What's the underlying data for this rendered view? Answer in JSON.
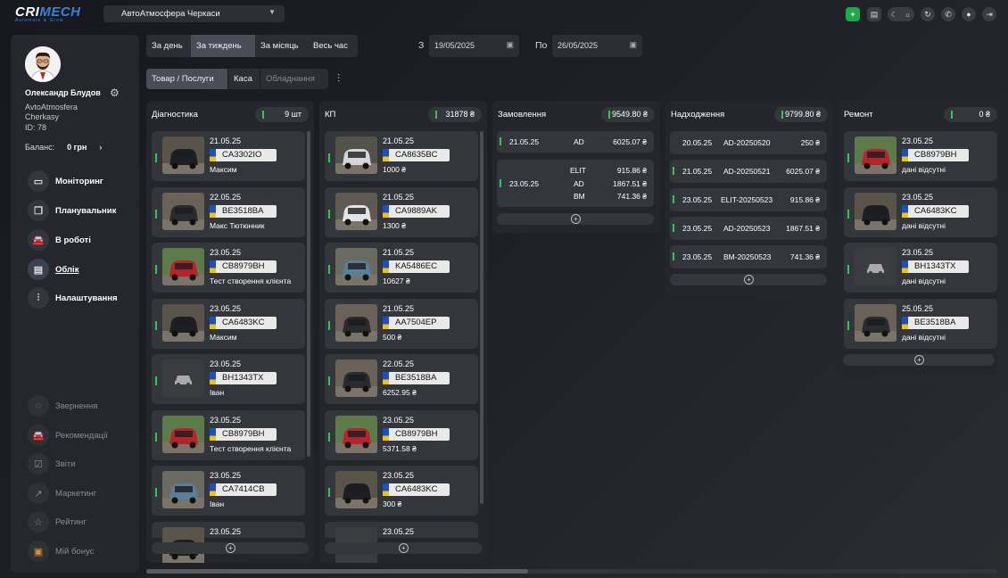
{
  "brand": {
    "name_a": "CRI",
    "name_b": "MECH",
    "tagline": "Automate & Grow",
    "accent": "#3b82d9"
  },
  "station": {
    "selected": "АвтоАтмосфера Черкаси"
  },
  "topbar": {
    "icons": [
      "add-icon",
      "calendar-box-icon",
      "moon-icon",
      "sun-icon",
      "refresh-icon",
      "phone-icon",
      "chat-icon",
      "logout-icon"
    ]
  },
  "user": {
    "name": "Олександр Блудов",
    "company": "AvtoAtmosfera",
    "city": "Cherkasy",
    "id": "ID: 78",
    "balance_label": "Баланс:",
    "balance_value": "0 грн",
    "balance_arrow": "›"
  },
  "nav": [
    {
      "label": "Моніторинг",
      "icon": "camera-icon"
    },
    {
      "label": "Планувальник",
      "icon": "pages-icon"
    },
    {
      "label": "В роботі",
      "icon": "car-icon"
    },
    {
      "label": "Облік",
      "icon": "document-icon",
      "active": true
    },
    {
      "label": "Налаштування",
      "icon": "sliders-icon"
    }
  ],
  "nav_bottom": [
    {
      "label": "Звернення",
      "icon": "message-icon"
    },
    {
      "label": "Рекомендації",
      "icon": "car-icon"
    },
    {
      "label": "Звіти",
      "icon": "checklist-icon"
    },
    {
      "label": "Маркетинг",
      "icon": "chart-icon"
    },
    {
      "label": "Рейтинг",
      "icon": "star-icon"
    },
    {
      "label": "Мій бонус",
      "icon": "gift-icon"
    }
  ],
  "period": {
    "buttons": [
      "За день",
      "За тиждень",
      "За місяць",
      "Весь час"
    ],
    "selected": "За тиждень",
    "from_label": "З",
    "from": "19/05/2025",
    "to_label": "По",
    "to": "26/05/2025"
  },
  "tabs": {
    "items": [
      "Товар / Послуги",
      "Каса",
      "Обладнання"
    ],
    "selected": "Товар / Послуги"
  },
  "columns": {
    "diag": {
      "title": "Діагностика",
      "badge": "9 шт",
      "cards": [
        {
          "date": "21.05.25",
          "plate": "CA3302IO",
          "sub": "Максим",
          "car": "dark-suv"
        },
        {
          "date": "22.05.25",
          "plate": "BE3518BA",
          "sub": "Макс Тютюнник",
          "car": "dark-wagon"
        },
        {
          "date": "23.05.25",
          "plate": "CB8979BH",
          "sub": "Тест створення клієнта",
          "car": "red"
        },
        {
          "date": "23.05.25",
          "plate": "CA6483KC",
          "sub": "Максим",
          "car": "dark-suv"
        },
        {
          "date": "23.05.25",
          "plate": "BH1343TX",
          "sub": "Іван",
          "car": "none"
        },
        {
          "date": "23.05.25",
          "plate": "CB8979BH",
          "sub": "Тест створення клієнта",
          "car": "red"
        },
        {
          "date": "23.05.25",
          "plate": "CA7414CB",
          "sub": "Іван",
          "car": "blue"
        },
        {
          "date": "23.05.25",
          "plate": "",
          "sub": "",
          "car": "dark-suv"
        }
      ]
    },
    "kp": {
      "title": "КП",
      "badge": "31878 ₴",
      "cards": [
        {
          "date": "21.05.25",
          "plate": "CA8635BC",
          "sub": "1000 ₴",
          "car": "van"
        },
        {
          "date": "21.05.25",
          "plate": "CA9889AK",
          "sub": "1300 ₴",
          "car": "white"
        },
        {
          "date": "21.05.25",
          "plate": "KA5486EC",
          "sub": "10627 ₴",
          "car": "blue"
        },
        {
          "date": "21.05.25",
          "plate": "AA7504EP",
          "sub": "500 ₴",
          "car": "dark-wagon"
        },
        {
          "date": "22.05.25",
          "plate": "BE3518BA",
          "sub": "6252.95 ₴",
          "car": "dark-wagon"
        },
        {
          "date": "23.05.25",
          "plate": "CB8979BH",
          "sub": "5371.58 ₴",
          "car": "red"
        },
        {
          "date": "23.05.25",
          "plate": "CA6483KC",
          "sub": "300 ₴",
          "car": "dark-suv"
        },
        {
          "date": "23.05.25",
          "plate": "",
          "sub": "",
          "car": "none"
        }
      ]
    },
    "orders": {
      "title": "Замовлення",
      "badge": "9549.80 ₴",
      "rows": [
        {
          "date": "21.05.25",
          "lines": [
            {
              "code": "AD",
              "amount": "6025.07 ₴"
            }
          ]
        },
        {
          "date": "23.05.25",
          "lines": [
            {
              "code": "ELIT",
              "amount": "915.86 ₴"
            },
            {
              "code": "AD",
              "amount": "1867.51 ₴"
            },
            {
              "code": "BM",
              "amount": "741.36 ₴"
            }
          ]
        }
      ]
    },
    "income": {
      "title": "Надходження",
      "badge": "9799.80 ₴",
      "rows": [
        {
          "date": "20.05.25",
          "code": "AD-20250520",
          "amount": "250 ₴",
          "flag": false
        },
        {
          "date": "21.05.25",
          "code": "AD-20250521",
          "amount": "6025.07 ₴",
          "flag": true
        },
        {
          "date": "23.05.25",
          "code": "ELIT-20250523",
          "amount": "915.86 ₴",
          "flag": true
        },
        {
          "date": "23.05.25",
          "code": "AD-20250523",
          "amount": "1867.51 ₴",
          "flag": true
        },
        {
          "date": "23.05.25",
          "code": "BM-20250523",
          "amount": "741.36 ₴",
          "flag": true
        }
      ]
    },
    "repair": {
      "title": "Ремонт",
      "badge": "0 ₴",
      "cards": [
        {
          "date": "23.05.25",
          "plate": "CB8979BH",
          "sub": "дані відсутні",
          "car": "red"
        },
        {
          "date": "23.05.25",
          "plate": "CA6483KC",
          "sub": "дані відсутні",
          "car": "dark-suv"
        },
        {
          "date": "23.05.25",
          "plate": "BH1343TX",
          "sub": "дані відсутні",
          "car": "none"
        },
        {
          "date": "25.05.25",
          "plate": "BE3518BA",
          "sub": "дані відсутні",
          "car": "dark-wagon"
        }
      ]
    }
  },
  "add_symbol": "+"
}
